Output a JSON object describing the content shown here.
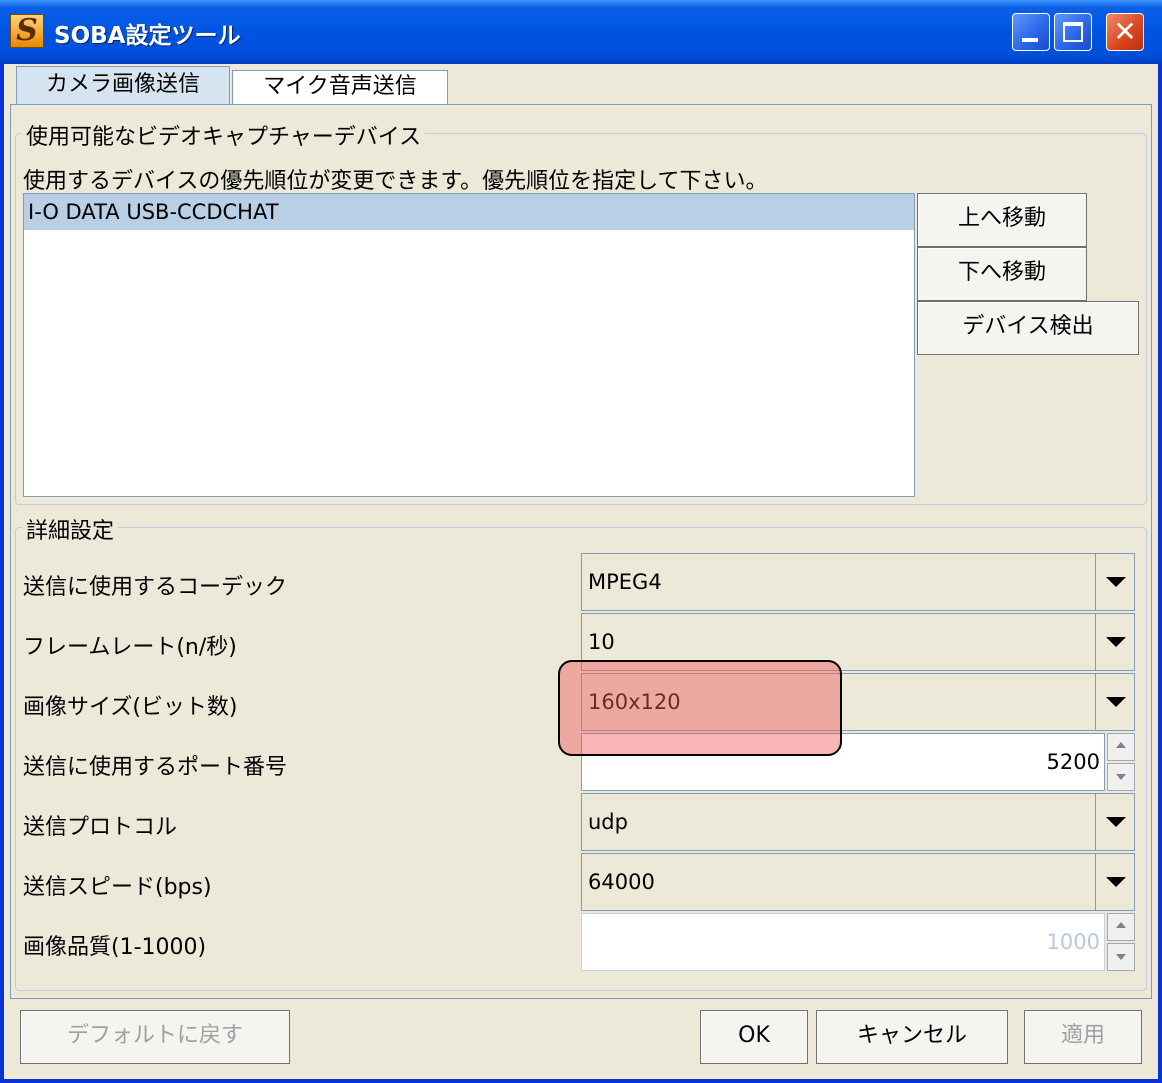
{
  "window": {
    "title": "SOBA設定ツール",
    "icon_letter": "S",
    "controls": [
      "minimize-icon",
      "maximize-icon",
      "close-icon"
    ]
  },
  "tabs": [
    {
      "label": "カメラ画像送信",
      "active": true
    },
    {
      "label": "マイク音声送信",
      "active": false
    }
  ],
  "devices": {
    "legend": "使用可能なビデオキャプチャーデバイス",
    "description": "使用するデバイスの優先順位が変更できます。優先順位を指定して下さい。",
    "items": [
      "I-O DATA USB-CCDCHAT"
    ],
    "buttons": {
      "move_up": "上へ移動",
      "move_down": "下へ移動",
      "detect": "デバイス検出"
    }
  },
  "details": {
    "legend": "詳細設定",
    "codec": {
      "label": "送信に使用するコーデック",
      "value": "MPEG4"
    },
    "framerate": {
      "label": "フレームレート(n/秒)",
      "value": "10"
    },
    "image_size": {
      "label": "画像サイズ(ビット数)",
      "value": "160x120"
    },
    "port": {
      "label": "送信に使用するポート番号",
      "value": "5200"
    },
    "protocol": {
      "label": "送信プロトコル",
      "value": "udp"
    },
    "speed": {
      "label": "送信スピード(bps)",
      "value": "64000"
    },
    "quality": {
      "label": "画像品質(1-1000)",
      "value": "1000"
    }
  },
  "footer": {
    "reset": "デフォルトに戻す",
    "ok": "OK",
    "cancel": "キャンセル",
    "apply": "適用"
  },
  "colors": {
    "title_bar": "#0054e3",
    "selection": "#b8cfe5",
    "highlight": "#f05a5a"
  }
}
